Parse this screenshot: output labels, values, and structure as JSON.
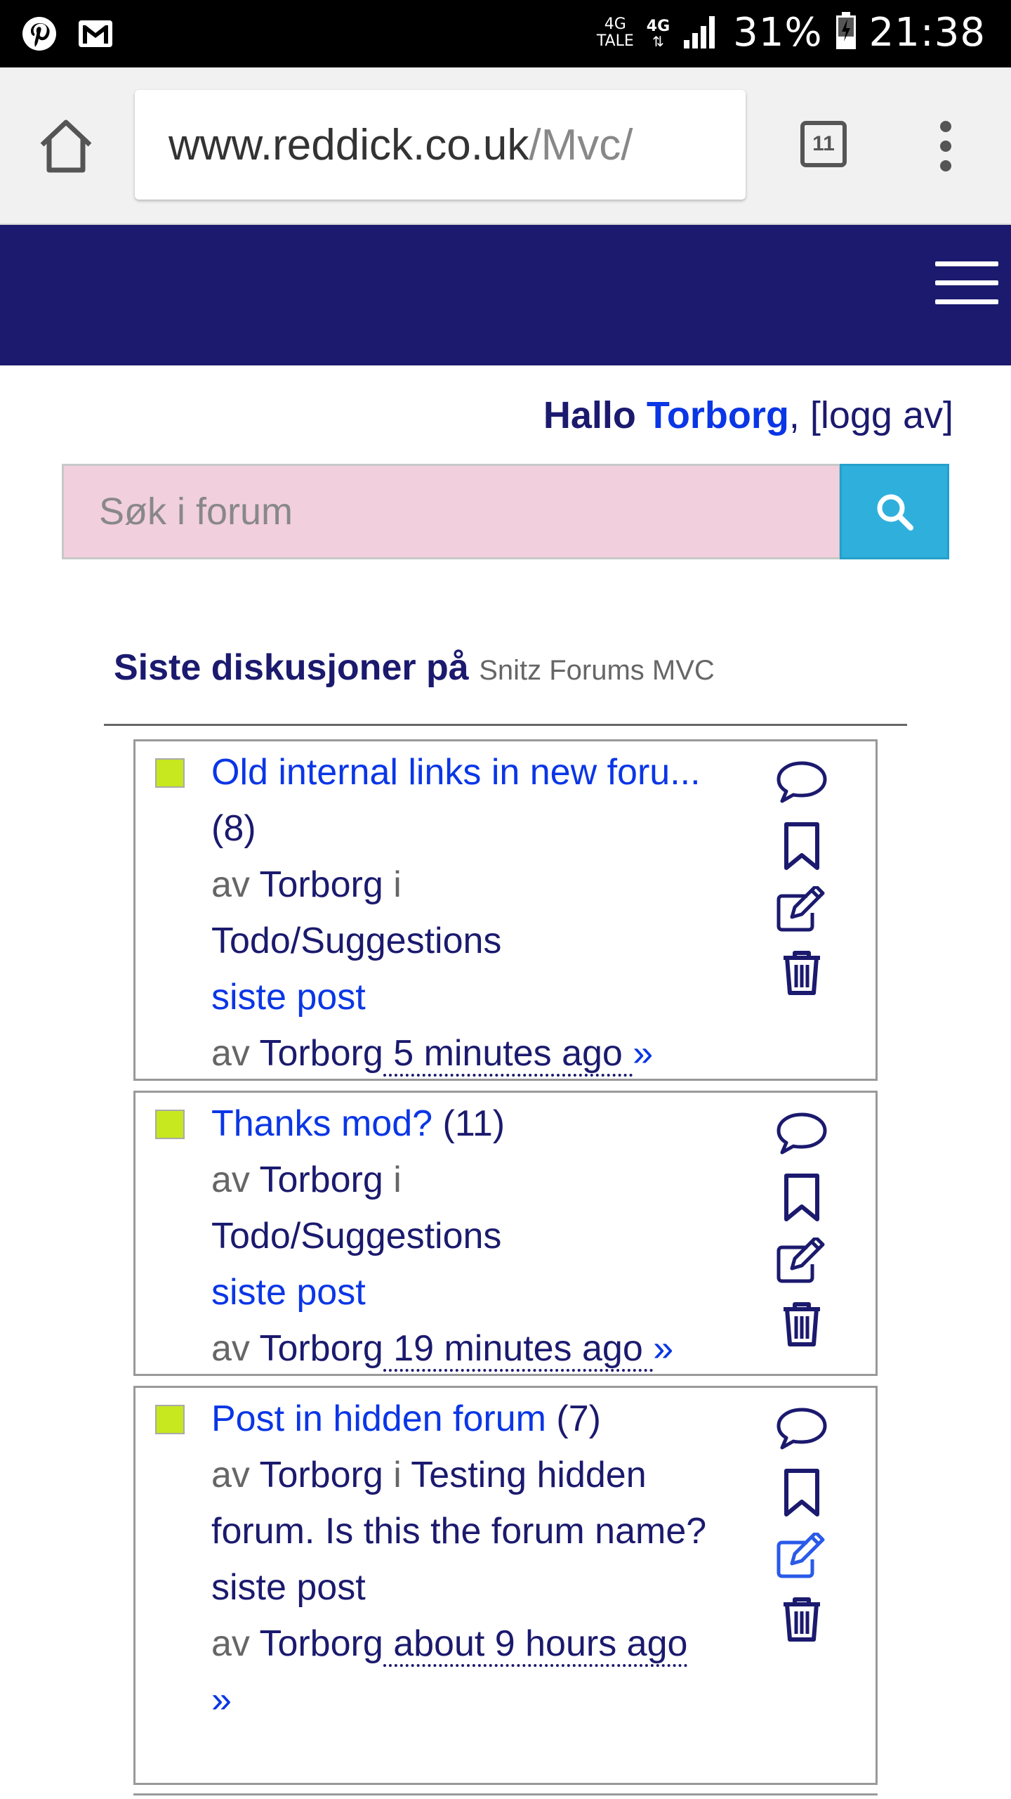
{
  "status_bar": {
    "net1_top": "4G",
    "net1_bottom": "TALE",
    "net2": "4G",
    "battery": "31%",
    "time": "21:38"
  },
  "browser": {
    "url_domain": "www.reddick.co.uk",
    "url_path": "/Mvc/",
    "tab_count": "11"
  },
  "greeting": {
    "hallo": "Hallo",
    "user": "Torborg",
    "comma": ",",
    "logout": "[logg av]"
  },
  "search": {
    "placeholder": "Søk i forum"
  },
  "section": {
    "title": "Siste diskusjoner på",
    "site": "Snitz Forums MVC"
  },
  "labels": {
    "by": "av",
    "in": "i",
    "last_post": "siste post",
    "arrow": "»"
  },
  "topics": [
    {
      "title": "Old internal links in new foru...",
      "count": "(8)",
      "author": "Torborg",
      "forum": "Todo/Suggestions",
      "last_author": "Torborg",
      "last_time": " 5 minutes ago "
    },
    {
      "title": "Thanks mod?",
      "count": "(11)",
      "author": "Torborg",
      "forum": "Todo/Suggestions",
      "last_author": "Torborg",
      "last_time": " 19 minutes ago "
    },
    {
      "title": "Post in hidden forum",
      "count": "(7)",
      "author": "Torborg",
      "forum": "Testing hidden forum. Is this the forum name?",
      "last_author": "Torborg",
      "last_time": " about 9 hours ago "
    }
  ],
  "colors": {
    "header": "#1b1a6e",
    "link": "#0a36e6",
    "search_bg": "#f2cfdd",
    "search_button": "#2fb0dc"
  }
}
